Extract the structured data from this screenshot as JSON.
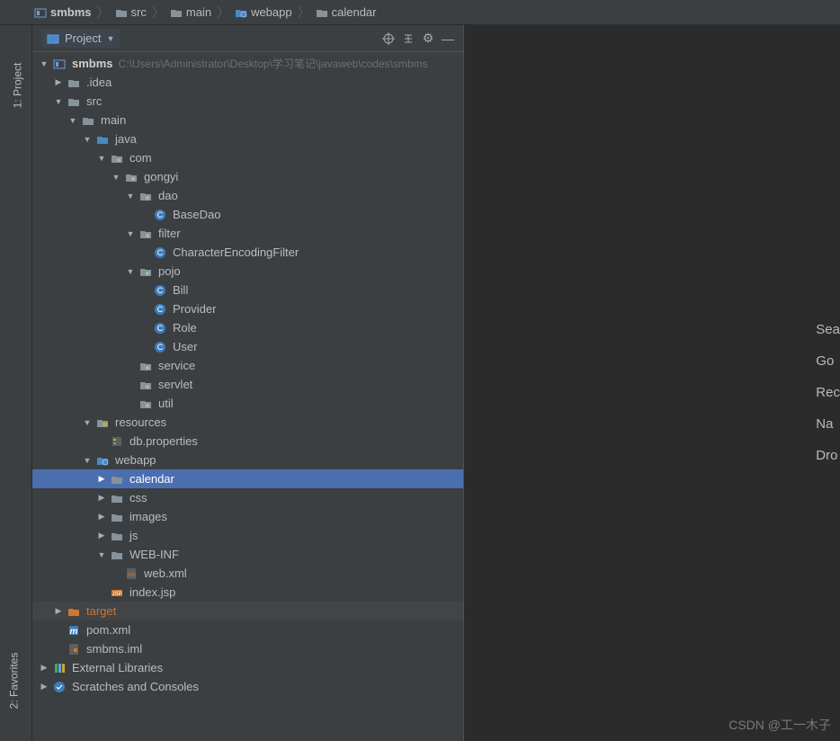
{
  "breadcrumbs": [
    {
      "label": "smbms",
      "icon": "module",
      "bold": true
    },
    {
      "label": "src",
      "icon": "folder"
    },
    {
      "label": "main",
      "icon": "folder"
    },
    {
      "label": "webapp",
      "icon": "webfolder"
    },
    {
      "label": "calendar",
      "icon": "folder"
    }
  ],
  "sidebar": {
    "project_tab": "1: Project",
    "favorites_tab": "2: Favorites"
  },
  "toolwindow": {
    "title": "Project",
    "actions": {
      "locate": "Select Opened File",
      "expand": "Expand All",
      "settings": "Settings",
      "hide": "Hide"
    }
  },
  "tree": [
    {
      "id": "root",
      "depth": 0,
      "arrow": "down",
      "icon": "module",
      "label": "smbms",
      "bold": true,
      "hint": "C:\\Users\\Administrator\\Desktop\\学习笔记\\javaweb\\codes\\smbms"
    },
    {
      "id": "idea",
      "depth": 1,
      "arrow": "right",
      "icon": "folder",
      "label": ".idea"
    },
    {
      "id": "src",
      "depth": 1,
      "arrow": "down",
      "icon": "folder",
      "label": "src"
    },
    {
      "id": "main",
      "depth": 2,
      "arrow": "down",
      "icon": "folder",
      "label": "main"
    },
    {
      "id": "java",
      "depth": 3,
      "arrow": "down",
      "icon": "srcfolder",
      "label": "java"
    },
    {
      "id": "com",
      "depth": 4,
      "arrow": "down",
      "icon": "package",
      "label": "com"
    },
    {
      "id": "gongyi",
      "depth": 5,
      "arrow": "down",
      "icon": "package",
      "label": "gongyi"
    },
    {
      "id": "dao",
      "depth": 6,
      "arrow": "down",
      "icon": "package",
      "label": "dao"
    },
    {
      "id": "basedao",
      "depth": 7,
      "arrow": "",
      "icon": "class",
      "label": "BaseDao"
    },
    {
      "id": "filter",
      "depth": 6,
      "arrow": "down",
      "icon": "package",
      "label": "filter"
    },
    {
      "id": "cef",
      "depth": 7,
      "arrow": "",
      "icon": "class",
      "label": "CharacterEncodingFilter"
    },
    {
      "id": "pojo",
      "depth": 6,
      "arrow": "down",
      "icon": "package",
      "label": "pojo"
    },
    {
      "id": "bill",
      "depth": 7,
      "arrow": "",
      "icon": "class",
      "label": "Bill"
    },
    {
      "id": "provider",
      "depth": 7,
      "arrow": "",
      "icon": "class",
      "label": "Provider"
    },
    {
      "id": "role",
      "depth": 7,
      "arrow": "",
      "icon": "class",
      "label": "Role"
    },
    {
      "id": "user",
      "depth": 7,
      "arrow": "",
      "icon": "class",
      "label": "User"
    },
    {
      "id": "service",
      "depth": 6,
      "arrow": "",
      "icon": "package",
      "label": "service"
    },
    {
      "id": "servlet",
      "depth": 6,
      "arrow": "",
      "icon": "package",
      "label": "servlet"
    },
    {
      "id": "util",
      "depth": 6,
      "arrow": "",
      "icon": "package",
      "label": "util"
    },
    {
      "id": "resources",
      "depth": 3,
      "arrow": "down",
      "icon": "resfolder",
      "label": "resources"
    },
    {
      "id": "dbprops",
      "depth": 4,
      "arrow": "",
      "icon": "props",
      "label": "db.properties"
    },
    {
      "id": "webapp",
      "depth": 3,
      "arrow": "down",
      "icon": "webfolder",
      "label": "webapp"
    },
    {
      "id": "calendar",
      "depth": 4,
      "arrow": "right",
      "icon": "folder",
      "label": "calendar",
      "selected": true
    },
    {
      "id": "css",
      "depth": 4,
      "arrow": "right",
      "icon": "folder",
      "label": "css"
    },
    {
      "id": "images",
      "depth": 4,
      "arrow": "right",
      "icon": "folder",
      "label": "images"
    },
    {
      "id": "js",
      "depth": 4,
      "arrow": "right",
      "icon": "folder",
      "label": "js"
    },
    {
      "id": "webinf",
      "depth": 4,
      "arrow": "down",
      "icon": "folder",
      "label": "WEB-INF"
    },
    {
      "id": "webxml",
      "depth": 5,
      "arrow": "",
      "icon": "xml",
      "label": "web.xml"
    },
    {
      "id": "indexjsp",
      "depth": 4,
      "arrow": "",
      "icon": "jsp",
      "label": "index.jsp"
    },
    {
      "id": "target",
      "depth": 1,
      "arrow": "right",
      "icon": "excluded",
      "label": "target",
      "orange": true,
      "mutedbg": true
    },
    {
      "id": "pom",
      "depth": 1,
      "arrow": "",
      "icon": "maven",
      "label": "pom.xml"
    },
    {
      "id": "iml",
      "depth": 1,
      "arrow": "",
      "icon": "ijfile",
      "label": "smbms.iml"
    },
    {
      "id": "extlib",
      "depth": 0,
      "arrow": "right",
      "icon": "libfolder",
      "label": "External Libraries"
    },
    {
      "id": "scratch",
      "depth": 0,
      "arrow": "right",
      "icon": "scratch",
      "label": "Scratches and Consoles"
    }
  ],
  "welcome": {
    "items": [
      "Sea",
      "Go",
      "Rec",
      "Na",
      "Dro"
    ]
  },
  "watermark": "CSDN @工一木子"
}
